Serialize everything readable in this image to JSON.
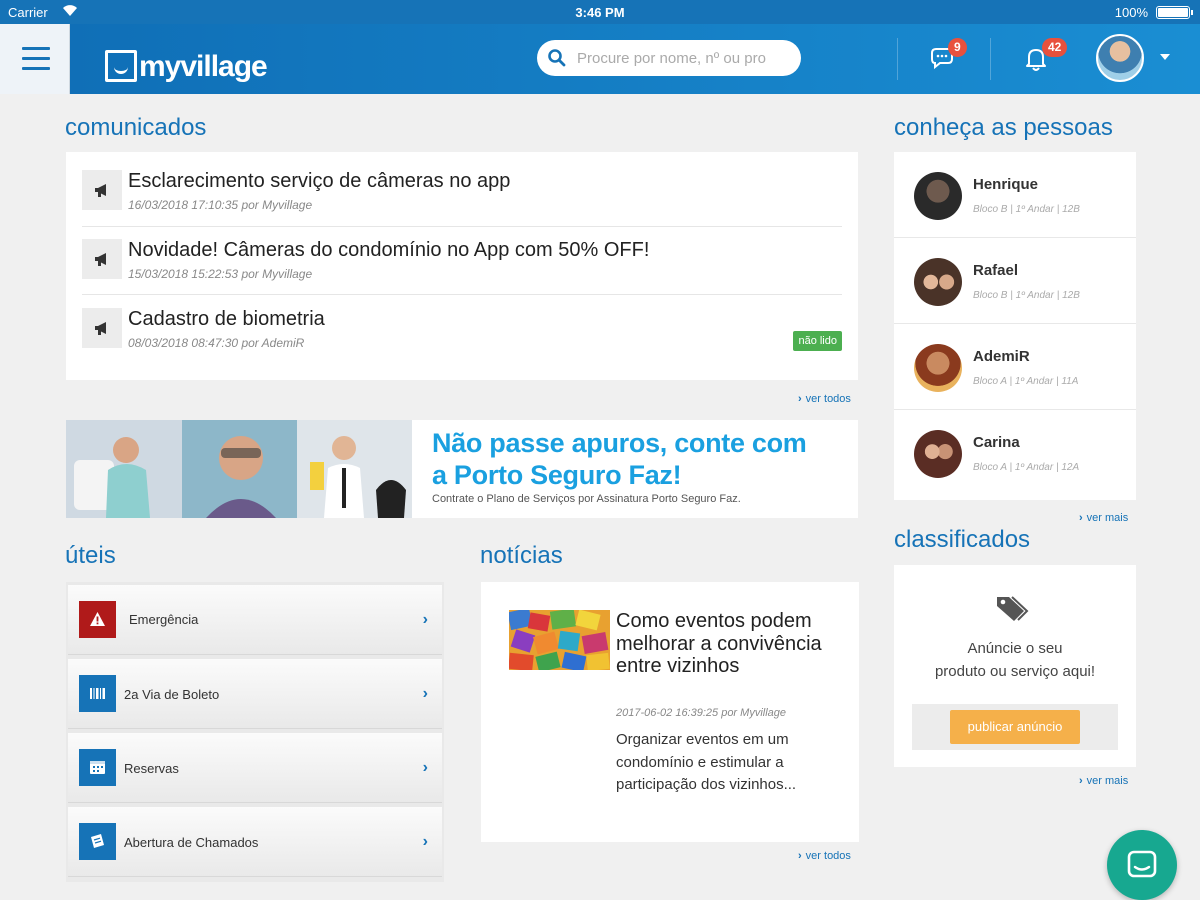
{
  "status_bar": {
    "carrier": "Carrier",
    "time": "3:46 PM",
    "battery": "100%"
  },
  "header": {
    "logo": "myvillage",
    "search_placeholder": "Procure por nome, nº ou pro",
    "chat_count": "9",
    "notification_count": "42"
  },
  "comunicados": {
    "title": "comunicados",
    "items": [
      {
        "title": "Esclarecimento serviço de câmeras no app",
        "meta": "16/03/2018 17:10:35 por Myvillage"
      },
      {
        "title": "Novidade! Câmeras do condomínio no App com 50% OFF!",
        "meta": "15/03/2018 15:22:53 por Myvillage"
      },
      {
        "title": "Cadastro de biometria",
        "meta": "08/03/2018 08:47:30 por AdemiR",
        "badge": "não lido"
      }
    ],
    "see_all": "ver todos"
  },
  "banner": {
    "headline_1": "Não passe apuros, conte com",
    "headline_2": "a Porto Seguro Faz!",
    "subtext": "Contrate o Plano de Serviços por Assinatura Porto Seguro Faz."
  },
  "uteis": {
    "title": "úteis",
    "items": [
      {
        "label": "Emergência",
        "icon": "warning-icon",
        "color": "#b01a1a"
      },
      {
        "label": "2a Via de Boleto",
        "icon": "barcode-icon",
        "color": "#1673b7"
      },
      {
        "label": "Reservas",
        "icon": "calendar-icon",
        "color": "#1673b7"
      },
      {
        "label": "Abertura de Chamados",
        "icon": "ticket-icon",
        "color": "#1673b7"
      }
    ]
  },
  "noticias": {
    "title": "notícias",
    "item": {
      "title": "Como eventos podem melhorar a convivência entre vizinhos",
      "meta": "2017-06-02 16:39:25 por Myvillage",
      "excerpt": "Organizar eventos em um condomínio e estimular a participação dos vizinhos..."
    },
    "see_all": "ver todos"
  },
  "pessoas": {
    "title": "conheça as pessoas",
    "people": [
      {
        "name": "Henrique",
        "detail": "Bloco B | 1º Andar | 12B"
      },
      {
        "name": "Rafael",
        "detail": "Bloco B | 1º Andar | 12B"
      },
      {
        "name": "AdemiR",
        "detail": "Bloco A | 1º Andar | 11A"
      },
      {
        "name": "Carina",
        "detail": "Bloco A | 1º Andar | 12A"
      }
    ],
    "see_more": "ver mais"
  },
  "classificados": {
    "title": "classificados",
    "line_1": "Anúncie o seu",
    "line_2": "produto ou serviço aqui!",
    "button": "publicar anúncio",
    "see_more": "ver mais"
  },
  "colors": {
    "brand": "#1673b7",
    "header": "#1a8ed3",
    "badge": "#e8513d",
    "unread": "#4caf50",
    "cta": "#f5b04a",
    "fab": "#17a890"
  }
}
